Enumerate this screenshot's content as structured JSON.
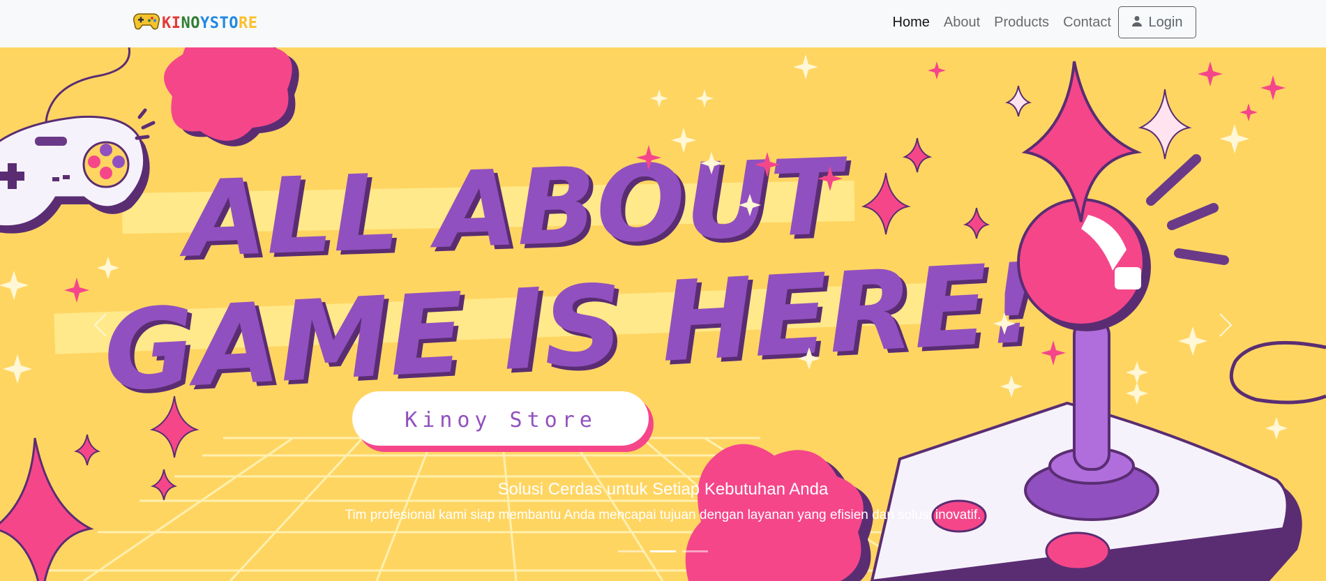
{
  "navbar": {
    "brand": {
      "letters": [
        {
          "char": "K",
          "color": "#e53935"
        },
        {
          "char": "I",
          "color": "#e53935"
        },
        {
          "char": "N",
          "color": "#2e7d32"
        },
        {
          "char": "O",
          "color": "#2e7d32"
        },
        {
          "char": "Y",
          "color": "#1e88e5"
        },
        {
          "char": "S",
          "color": "#1e88e5"
        },
        {
          "char": "T",
          "color": "#1e88e5"
        },
        {
          "char": "O",
          "color": "#1e88e5"
        },
        {
          "char": "R",
          "color": "#fbc02d"
        },
        {
          "char": "E",
          "color": "#fbc02d"
        }
      ],
      "icon": "gamepad-icon"
    },
    "links": [
      {
        "label": "Home",
        "active": true
      },
      {
        "label": "About",
        "active": false
      },
      {
        "label": "Products",
        "active": false
      },
      {
        "label": "Contact",
        "active": false
      }
    ],
    "login": {
      "label": "Login",
      "icon": "user-icon"
    }
  },
  "hero": {
    "headline_line1": "ALL ABOUT",
    "headline_line2": "GAME IS HERE!",
    "badge_label": "Kinoy Store",
    "caption_title": "Solusi Cerdas untuk Setiap Kebutuhan Anda",
    "caption_text": "Tim profesional kami siap membantu Anda mencapai tujuan dengan layanan yang efisien dan solusi inovatif.",
    "slides_count": 3,
    "active_slide": 1,
    "colors": {
      "background": "#ffd562",
      "headline": "#9150bf",
      "pink": "#f5468a",
      "purple_dark": "#5a2d73",
      "grid": "#fff3b8"
    }
  }
}
